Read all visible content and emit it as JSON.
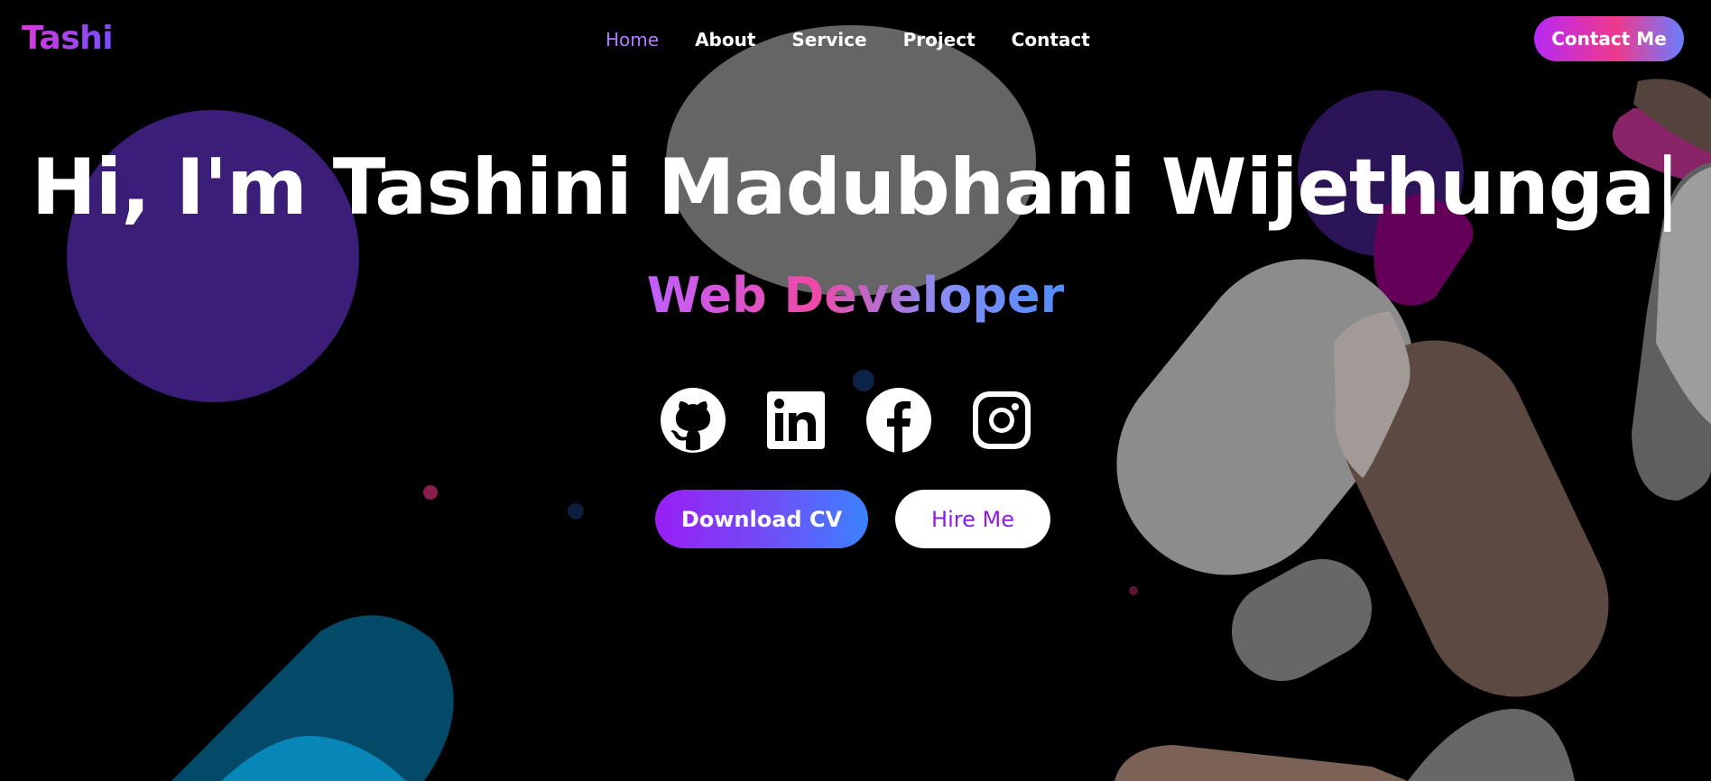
{
  "brand": {
    "logo": "Tashi"
  },
  "nav": {
    "items": [
      {
        "label": "Home",
        "active": true
      },
      {
        "label": "About"
      },
      {
        "label": "Service"
      },
      {
        "label": "Project"
      },
      {
        "label": "Contact"
      }
    ],
    "cta_label": "Contact Me"
  },
  "hero": {
    "heading": "Hi, I'm Tashini Madubhani Wijethunga",
    "cursor": "|",
    "role": "Web Developer"
  },
  "socials": [
    {
      "icon": "github-icon"
    },
    {
      "icon": "linkedin-icon"
    },
    {
      "icon": "facebook-icon"
    },
    {
      "icon": "instagram-icon"
    }
  ],
  "actions": {
    "download_cv": "Download CV",
    "hire_me": "Hire Me"
  },
  "colors": {
    "background": "#000000",
    "accent_purple": "#9a1ef5",
    "accent_pink": "#ee3a8c",
    "accent_blue": "#3b82ff",
    "nav_active": "#b07cff"
  }
}
